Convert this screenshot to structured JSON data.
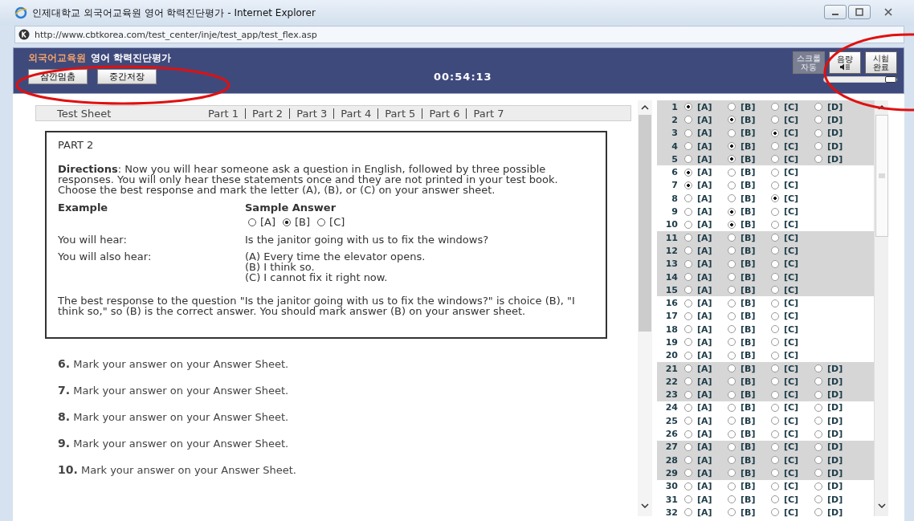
{
  "window": {
    "title": "인제대학교 외국어교육원 영어 학력진단평가 - Internet Explorer",
    "url": "http://www.cbtkorea.com/test_center/inje/test_app/test_flex.asp"
  },
  "header": {
    "org": "외국어교육원",
    "title": "영어 학력진단평가",
    "buttons": [
      {
        "label": "잠깐멈춤"
      },
      {
        "label": "중간저장"
      }
    ],
    "timer": "00:54:13",
    "scroll_button": {
      "lines": [
        "스크롤",
        "자동"
      ],
      "disabled": true
    },
    "volume_button": {
      "label": "음량"
    },
    "finish_button": {
      "lines": [
        "시험",
        "완료"
      ]
    },
    "volume": {
      "level": 1
    }
  },
  "nav": {
    "title": "Test Sheet",
    "parts": [
      {
        "label": "Part 1"
      },
      {
        "label": "Part 2"
      },
      {
        "label": "Part 3"
      },
      {
        "label": "Part 4"
      },
      {
        "label": "Part 5"
      },
      {
        "label": "Part 6"
      },
      {
        "label": "Part 7"
      }
    ]
  },
  "instructions": {
    "heading": "PART 2",
    "directions": "**Directions**: Now you will hear someone ask a question in English, followed by three possible responses. You will only hear these statements once and they are not printed in your test book. Choose the best response and mark the letter (A), (B), or (C) on your answer sheet.",
    "example_label": "Example",
    "sample_label": "Sample Answer",
    "sample_options": [
      {
        "label": "[A]",
        "selected": false
      },
      {
        "label": "[B]",
        "selected": true
      },
      {
        "label": "[C]",
        "selected": false
      }
    ],
    "rows": [
      {
        "label": "You will hear:",
        "lines": [
          "Is the janitor going with us to fix the windows?"
        ]
      },
      {
        "label": "You will also hear:",
        "lines": [
          "(A) Every time the elevator opens.",
          "(B) I think so.",
          "(C) I cannot fix it right now."
        ]
      }
    ],
    "explanation": "The best response to the question \"Is the janitor going with us to fix the windows?\" is choice (B), \"I think so,\" so (B) is the correct answer. You should mark answer (B) on your answer sheet."
  },
  "questions": [
    {
      "number": "6.",
      "text": "Mark your answer on your Answer Sheet."
    },
    {
      "number": "7.",
      "text": "Mark your answer on your Answer Sheet."
    },
    {
      "number": "8.",
      "text": "Mark your answer on your Answer Sheet."
    },
    {
      "number": "9.",
      "text": "Mark your answer on your Answer Sheet."
    },
    {
      "number": "10.",
      "text": "Mark your answer on your Answer Sheet."
    }
  ],
  "answer_sheet": {
    "rows": [
      {
        "number": "1",
        "shaded": true,
        "options": [
          {
            "label": "[A]",
            "selected": true
          },
          {
            "label": "[B]",
            "selected": false
          },
          {
            "label": "[C]",
            "selected": false
          },
          {
            "label": "[D]",
            "selected": false
          }
        ]
      },
      {
        "number": "2",
        "shaded": true,
        "options": [
          {
            "label": "[A]",
            "selected": false
          },
          {
            "label": "[B]",
            "selected": true
          },
          {
            "label": "[C]",
            "selected": false
          },
          {
            "label": "[D]",
            "selected": false
          }
        ]
      },
      {
        "number": "3",
        "shaded": true,
        "options": [
          {
            "label": "[A]",
            "selected": false
          },
          {
            "label": "[B]",
            "selected": false
          },
          {
            "label": "[C]",
            "selected": true
          },
          {
            "label": "[D]",
            "selected": false
          }
        ]
      },
      {
        "number": "4",
        "shaded": true,
        "options": [
          {
            "label": "[A]",
            "selected": false
          },
          {
            "label": "[B]",
            "selected": true
          },
          {
            "label": "[C]",
            "selected": false
          },
          {
            "label": "[D]",
            "selected": false
          }
        ]
      },
      {
        "number": "5",
        "shaded": true,
        "options": [
          {
            "label": "[A]",
            "selected": false
          },
          {
            "label": "[B]",
            "selected": true
          },
          {
            "label": "[C]",
            "selected": false
          },
          {
            "label": "[D]",
            "selected": false
          }
        ]
      },
      {
        "number": "6",
        "shaded": false,
        "options": [
          {
            "label": "[A]",
            "selected": true
          },
          {
            "label": "[B]",
            "selected": false
          },
          {
            "label": "[C]",
            "selected": false
          }
        ]
      },
      {
        "number": "7",
        "shaded": false,
        "options": [
          {
            "label": "[A]",
            "selected": true
          },
          {
            "label": "[B]",
            "selected": false
          },
          {
            "label": "[C]",
            "selected": false
          }
        ]
      },
      {
        "number": "8",
        "shaded": false,
        "options": [
          {
            "label": "[A]",
            "selected": false
          },
          {
            "label": "[B]",
            "selected": false
          },
          {
            "label": "[C]",
            "selected": true
          }
        ]
      },
      {
        "number": "9",
        "shaded": false,
        "options": [
          {
            "label": "[A]",
            "selected": false
          },
          {
            "label": "[B]",
            "selected": true
          },
          {
            "label": "[C]",
            "selected": false
          }
        ]
      },
      {
        "number": "10",
        "shaded": false,
        "options": [
          {
            "label": "[A]",
            "selected": false
          },
          {
            "label": "[B]",
            "selected": true
          },
          {
            "label": "[C]",
            "selected": false
          }
        ]
      },
      {
        "number": "11",
        "shaded": true,
        "options": [
          {
            "label": "[A]",
            "selected": false
          },
          {
            "label": "[B]",
            "selected": false
          },
          {
            "label": "[C]",
            "selected": false
          }
        ]
      },
      {
        "number": "12",
        "shaded": true,
        "options": [
          {
            "label": "[A]",
            "selected": false
          },
          {
            "label": "[B]",
            "selected": false
          },
          {
            "label": "[C]",
            "selected": false
          }
        ]
      },
      {
        "number": "13",
        "shaded": true,
        "options": [
          {
            "label": "[A]",
            "selected": false
          },
          {
            "label": "[B]",
            "selected": false
          },
          {
            "label": "[C]",
            "selected": false
          }
        ]
      },
      {
        "number": "14",
        "shaded": true,
        "options": [
          {
            "label": "[A]",
            "selected": false
          },
          {
            "label": "[B]",
            "selected": false
          },
          {
            "label": "[C]",
            "selected": false
          }
        ]
      },
      {
        "number": "15",
        "shaded": true,
        "options": [
          {
            "label": "[A]",
            "selected": false
          },
          {
            "label": "[B]",
            "selected": false
          },
          {
            "label": "[C]",
            "selected": false
          }
        ]
      },
      {
        "number": "16",
        "shaded": false,
        "options": [
          {
            "label": "[A]",
            "selected": false
          },
          {
            "label": "[B]",
            "selected": false
          },
          {
            "label": "[C]",
            "selected": false
          }
        ]
      },
      {
        "number": "17",
        "shaded": false,
        "options": [
          {
            "label": "[A]",
            "selected": false
          },
          {
            "label": "[B]",
            "selected": false
          },
          {
            "label": "[C]",
            "selected": false
          }
        ]
      },
      {
        "number": "18",
        "shaded": false,
        "options": [
          {
            "label": "[A]",
            "selected": false
          },
          {
            "label": "[B]",
            "selected": false
          },
          {
            "label": "[C]",
            "selected": false
          }
        ]
      },
      {
        "number": "19",
        "shaded": false,
        "options": [
          {
            "label": "[A]",
            "selected": false
          },
          {
            "label": "[B]",
            "selected": false
          },
          {
            "label": "[C]",
            "selected": false
          }
        ]
      },
      {
        "number": "20",
        "shaded": false,
        "options": [
          {
            "label": "[A]",
            "selected": false
          },
          {
            "label": "[B]",
            "selected": false
          },
          {
            "label": "[C]",
            "selected": false
          }
        ]
      },
      {
        "number": "21",
        "shaded": true,
        "options": [
          {
            "label": "[A]",
            "selected": false
          },
          {
            "label": "[B]",
            "selected": false
          },
          {
            "label": "[C]",
            "selected": false
          },
          {
            "label": "[D]",
            "selected": false
          }
        ]
      },
      {
        "number": "22",
        "shaded": true,
        "options": [
          {
            "label": "[A]",
            "selected": false
          },
          {
            "label": "[B]",
            "selected": false
          },
          {
            "label": "[C]",
            "selected": false
          },
          {
            "label": "[D]",
            "selected": false
          }
        ]
      },
      {
        "number": "23",
        "shaded": true,
        "options": [
          {
            "label": "[A]",
            "selected": false
          },
          {
            "label": "[B]",
            "selected": false
          },
          {
            "label": "[C]",
            "selected": false
          },
          {
            "label": "[D]",
            "selected": false
          }
        ]
      },
      {
        "number": "24",
        "shaded": false,
        "options": [
          {
            "label": "[A]",
            "selected": false
          },
          {
            "label": "[B]",
            "selected": false
          },
          {
            "label": "[C]",
            "selected": false
          },
          {
            "label": "[D]",
            "selected": false
          }
        ]
      },
      {
        "number": "25",
        "shaded": false,
        "options": [
          {
            "label": "[A]",
            "selected": false
          },
          {
            "label": "[B]",
            "selected": false
          },
          {
            "label": "[C]",
            "selected": false
          },
          {
            "label": "[D]",
            "selected": false
          }
        ]
      },
      {
        "number": "26",
        "shaded": false,
        "options": [
          {
            "label": "[A]",
            "selected": false
          },
          {
            "label": "[B]",
            "selected": false
          },
          {
            "label": "[C]",
            "selected": false
          },
          {
            "label": "[D]",
            "selected": false
          }
        ]
      },
      {
        "number": "27",
        "shaded": true,
        "options": [
          {
            "label": "[A]",
            "selected": false
          },
          {
            "label": "[B]",
            "selected": false
          },
          {
            "label": "[C]",
            "selected": false
          },
          {
            "label": "[D]",
            "selected": false
          }
        ]
      },
      {
        "number": "28",
        "shaded": true,
        "options": [
          {
            "label": "[A]",
            "selected": false
          },
          {
            "label": "[B]",
            "selected": false
          },
          {
            "label": "[C]",
            "selected": false
          },
          {
            "label": "[D]",
            "selected": false
          }
        ]
      },
      {
        "number": "29",
        "shaded": true,
        "options": [
          {
            "label": "[A]",
            "selected": false
          },
          {
            "label": "[B]",
            "selected": false
          },
          {
            "label": "[C]",
            "selected": false
          },
          {
            "label": "[D]",
            "selected": false
          }
        ]
      },
      {
        "number": "30",
        "shaded": false,
        "options": [
          {
            "label": "[A]",
            "selected": false
          },
          {
            "label": "[B]",
            "selected": false
          },
          {
            "label": "[C]",
            "selected": false
          },
          {
            "label": "[D]",
            "selected": false
          }
        ]
      },
      {
        "number": "31",
        "shaded": false,
        "options": [
          {
            "label": "[A]",
            "selected": false
          },
          {
            "label": "[B]",
            "selected": false
          },
          {
            "label": "[C]",
            "selected": false
          },
          {
            "label": "[D]",
            "selected": false
          }
        ]
      },
      {
        "number": "32",
        "shaded": false,
        "options": [
          {
            "label": "[A]",
            "selected": false
          },
          {
            "label": "[B]",
            "selected": false
          },
          {
            "label": "[C]",
            "selected": false
          },
          {
            "label": "[D]",
            "selected": false
          }
        ]
      }
    ]
  }
}
